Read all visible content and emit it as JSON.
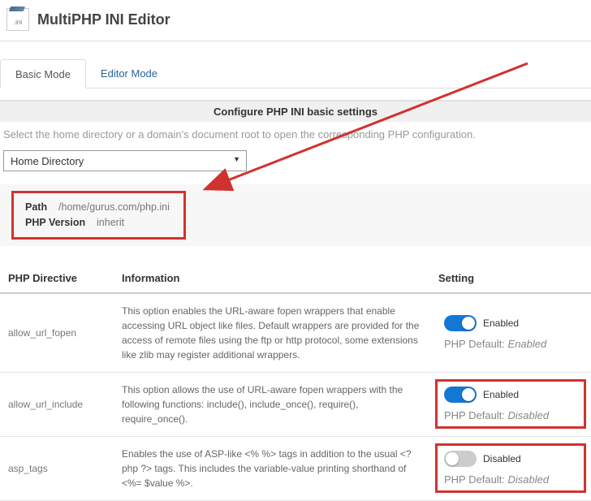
{
  "header": {
    "title": "MultiPHP INI Editor",
    "icon_text": ".ini"
  },
  "tabs": {
    "basic": "Basic Mode",
    "editor": "Editor Mode"
  },
  "section_title": "Configure PHP INI basic settings",
  "instruction": "Select the home directory or a domain's document root to open the corresponding PHP configuration.",
  "select": {
    "value": "Home Directory"
  },
  "info_box": {
    "path_label": "Path",
    "path_value": "/home/gurus.com/php.ini",
    "version_label": "PHP Version",
    "version_value": "inherit"
  },
  "columns": {
    "directive": "PHP Directive",
    "information": "Information",
    "setting": "Setting"
  },
  "rows": [
    {
      "directive": "allow_url_fopen",
      "info": "This option enables the URL-aware fopen wrappers that enable accessing URL object like files. Default wrappers are provided for the access of remote files using the ftp or http protocol, some extensions like zlib may register additional wrappers.",
      "toggle_on": true,
      "toggle_label": "Enabled",
      "default_prefix": "PHP Default: ",
      "default_value": "Enabled",
      "highlighted": false
    },
    {
      "directive": "allow_url_include",
      "info": "This option allows the use of URL-aware fopen wrappers with the following functions: include(), include_once(), require(), require_once().",
      "toggle_on": true,
      "toggle_label": "Enabled",
      "default_prefix": "PHP Default: ",
      "default_value": "Disabled",
      "highlighted": true
    },
    {
      "directive": "asp_tags",
      "info": "Enables the use of ASP-like <% %> tags in addition to the usual <?php ?> tags. This includes the variable-value printing shorthand of <%= $value %>.",
      "toggle_on": false,
      "toggle_label": "Disabled",
      "default_prefix": "PHP Default: ",
      "default_value": "Disabled",
      "highlighted": true
    }
  ]
}
